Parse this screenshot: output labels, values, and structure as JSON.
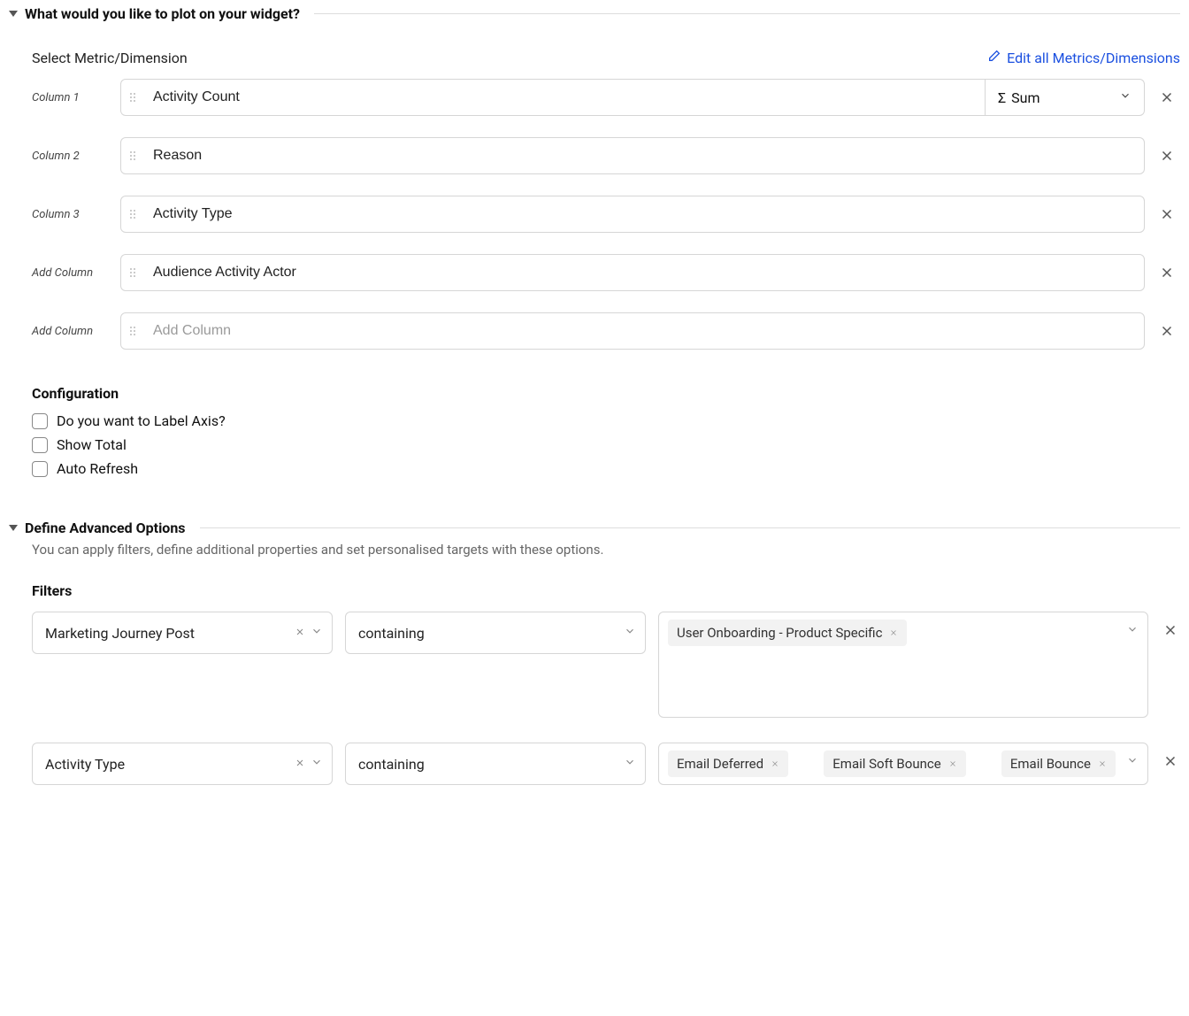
{
  "plot_section": {
    "title": "What would you like to plot on your widget?",
    "metric_label": "Select Metric/Dimension",
    "edit_link": "Edit all Metrics/Dimensions",
    "rows": [
      {
        "label": "Column 1",
        "value": "Activity Count",
        "agg": "Sum"
      },
      {
        "label": "Column 2",
        "value": "Reason"
      },
      {
        "label": "Column 3",
        "value": "Activity Type"
      },
      {
        "label": "Add Column",
        "value": "Audience Activity Actor"
      },
      {
        "label": "Add Column",
        "placeholder": "Add Column"
      }
    ]
  },
  "config": {
    "title": "Configuration",
    "items": [
      "Do you want to Label Axis?",
      "Show Total",
      "Auto Refresh"
    ]
  },
  "advanced": {
    "title": "Define Advanced Options",
    "subtitle": "You can apply filters, define additional properties and set personalised targets with these options.",
    "filters_title": "Filters",
    "filters": [
      {
        "field": "Marketing Journey Post",
        "op": "containing",
        "values": [
          "User Onboarding - Product Specific"
        ]
      },
      {
        "field": "Activity Type",
        "op": "containing",
        "values": [
          "Email Deferred",
          "Email Soft Bounce",
          "Email Bounce"
        ]
      }
    ]
  }
}
